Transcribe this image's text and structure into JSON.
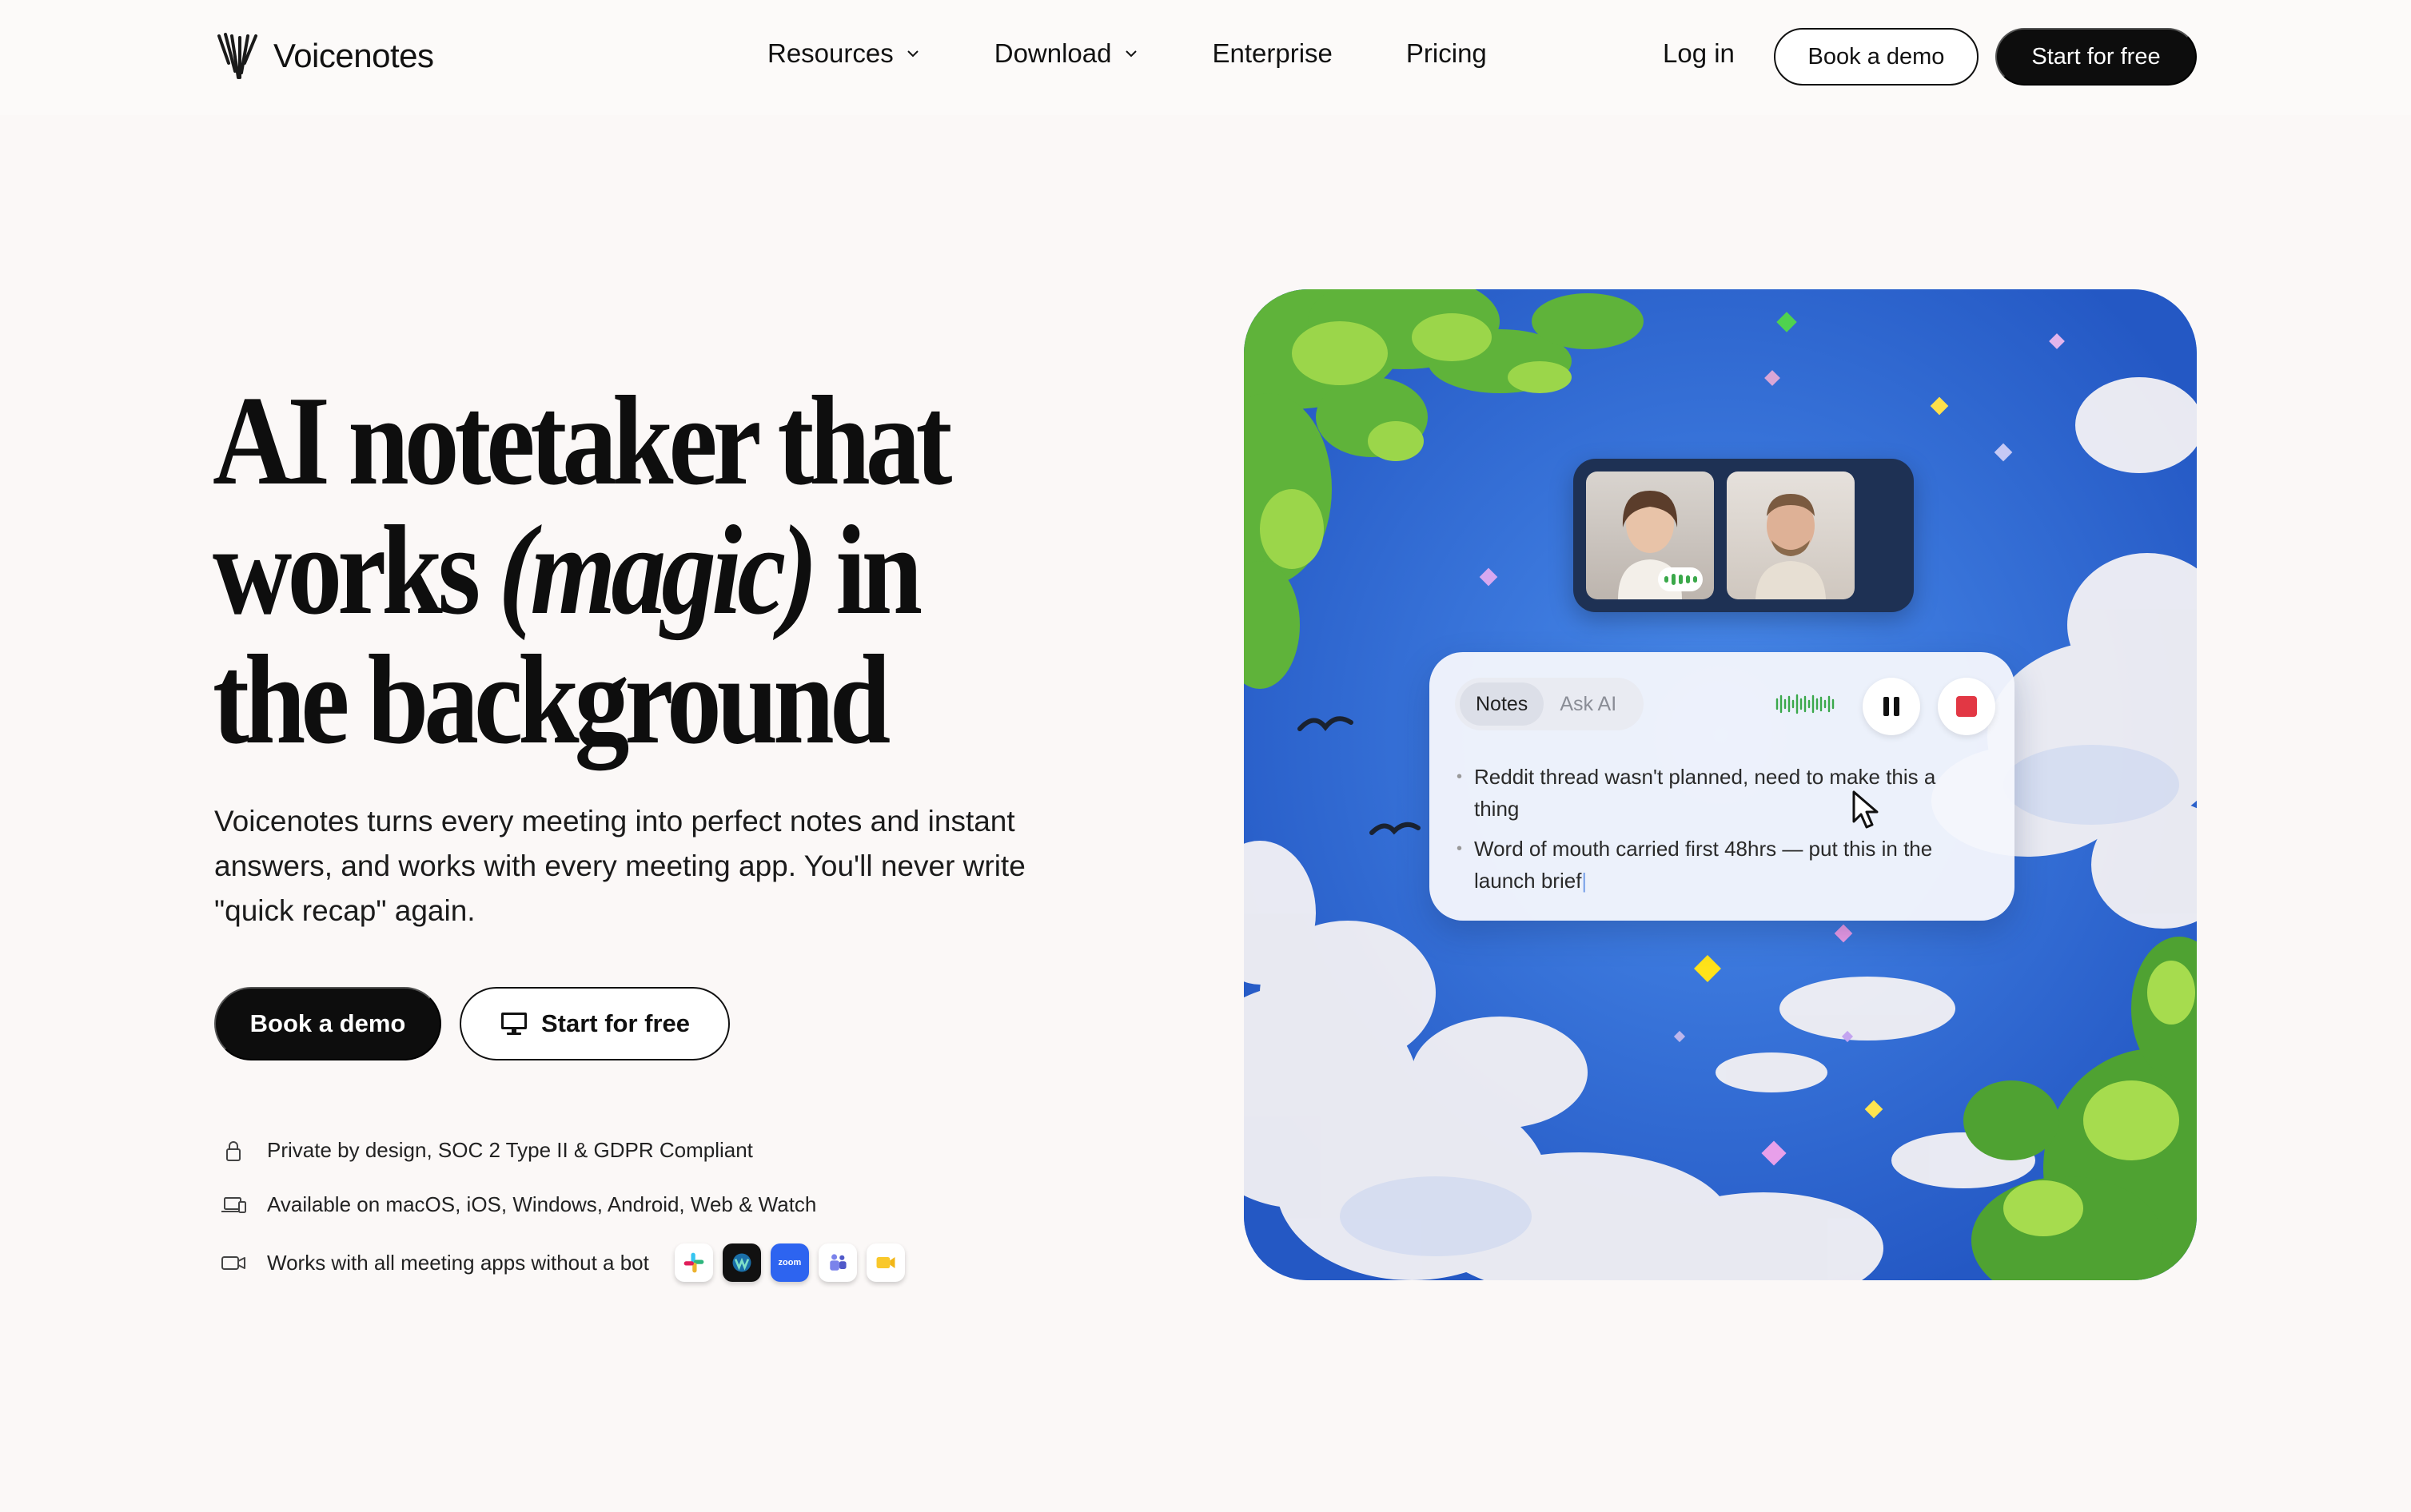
{
  "nav": {
    "logo_text": "Voicenotes",
    "links": [
      {
        "label": "Resources",
        "icon": "chevron-down-icon"
      },
      {
        "label": "Download",
        "icon": "chevron-down-icon"
      },
      {
        "label": "Enterprise"
      },
      {
        "label": "Pricing"
      }
    ],
    "login_label": "Log in",
    "book_demo_label": "Book a demo",
    "start_free_label": "Start for free"
  },
  "hero": {
    "title_line1": "AI notetaker that",
    "title_line2_pre": "works ",
    "title_line2_em": "(magic)",
    "title_line2_post": " in",
    "title_line3": "the background",
    "subtitle": "Voicenotes turns every meeting into perfect notes and instant answers, and works with every meeting app. You'll never write \"quick recap\" again.",
    "book_demo_label": "Book a demo",
    "start_free_label": "Start for free",
    "start_free_icon": "desktop-icon",
    "features": [
      {
        "icon": "lock-icon",
        "text": "Private by design, SOC 2 Type II & GDPR Compliant"
      },
      {
        "icon": "laptop-phone-icon",
        "text": "Available on macOS, iOS, Windows, Android, Web & Watch"
      },
      {
        "icon": "video-camera-icon",
        "text": "Works with all meeting apps without a bot"
      }
    ],
    "app_icons": [
      {
        "name": "slack-icon",
        "label": ""
      },
      {
        "name": "webex-icon",
        "label": ""
      },
      {
        "name": "zoom-icon",
        "label": "zoom"
      },
      {
        "name": "teams-icon",
        "label": ""
      },
      {
        "name": "google-meet-icon",
        "label": ""
      }
    ]
  },
  "widget": {
    "tabs": [
      "Notes",
      "Ask AI"
    ],
    "active_tab": "Notes",
    "notes": [
      "Reddit thread wasn't planned, need to make this a thing",
      "Word of mouth carried first 48hrs — put this in the launch brief"
    ],
    "colors": {
      "stop": "#e23744",
      "wave": "#3aa84a"
    }
  },
  "colors": {
    "page_bg": "#fbf8f7",
    "primary": "#0d0d0d",
    "sky": "#3d82e6"
  }
}
